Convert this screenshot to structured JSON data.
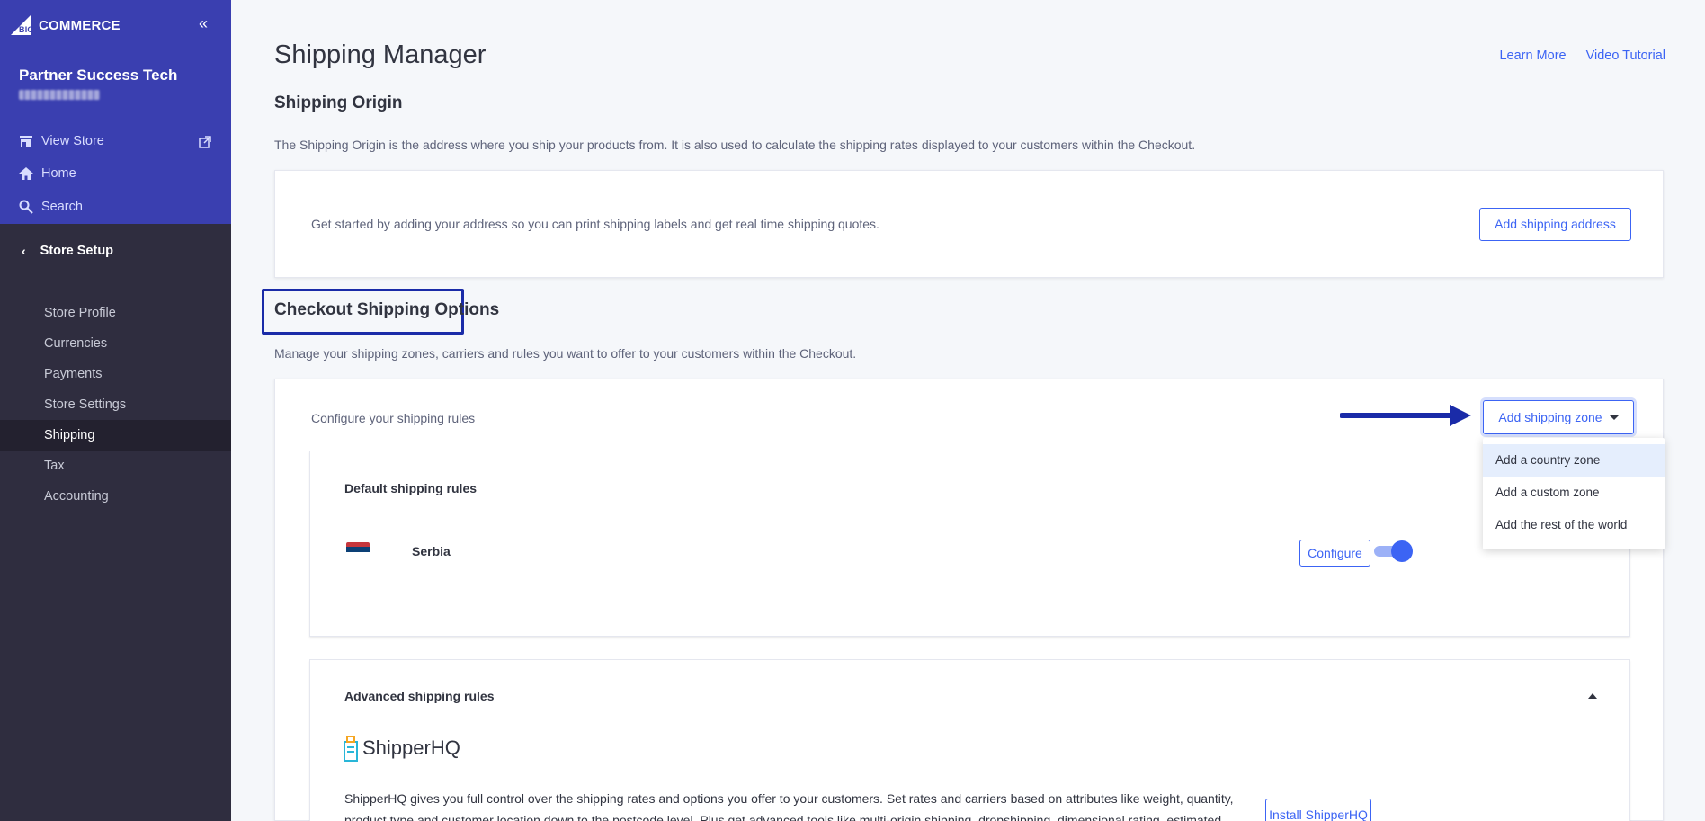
{
  "brand": {
    "logo_text": "COMMERCE",
    "logo_mark": "BIG"
  },
  "sidebar": {
    "store_name": "Partner Success Tech",
    "top_items": [
      {
        "label": "View Store"
      },
      {
        "label": "Home"
      },
      {
        "label": "Search"
      }
    ],
    "section": "Store Setup",
    "sub_items": [
      {
        "label": "Store Profile"
      },
      {
        "label": "Currencies"
      },
      {
        "label": "Payments"
      },
      {
        "label": "Store Settings"
      },
      {
        "label": "Shipping"
      },
      {
        "label": "Tax"
      },
      {
        "label": "Accounting"
      }
    ],
    "active": "Shipping"
  },
  "header": {
    "title": "Shipping Manager",
    "links": {
      "learn_more": "Learn More",
      "video_tutorial": "Video Tutorial"
    }
  },
  "origin": {
    "title": "Shipping Origin",
    "description": "The Shipping Origin is the address where you ship your products from. It is also used to calculate the shipping rates displayed to your customers within the Checkout.",
    "card_text": "Get started by adding your address so you can print shipping labels and get real time shipping quotes.",
    "button": "Add shipping address"
  },
  "checkout": {
    "title": "Checkout Shipping Options",
    "description": "Manage your shipping zones, carriers and rules you want to offer to your customers within the Checkout.",
    "configure_text": "Configure your shipping rules",
    "add_zone_button": "Add shipping zone",
    "dropdown": [
      {
        "label": "Add a country zone"
      },
      {
        "label": "Add a custom zone"
      },
      {
        "label": "Add the rest of the world"
      }
    ],
    "default_rules": {
      "title": "Default shipping rules",
      "country": "Serbia",
      "enabled": true,
      "configure_button": "Configure"
    },
    "advanced_rules": {
      "title": "Advanced shipping rules",
      "logo_text": "ShipperHQ",
      "description": "ShipperHQ gives you full control over the shipping rates and options you offer to your customers. Set rates and carriers based on attributes like weight, quantity, product type and customer location down to the postcode level. Plus get advanced tools like multi-origin shipping, dropshipping, dimensional rating, estimated",
      "install_button": "Install ShipperHQ"
    }
  },
  "colors": {
    "sidebar_top": "#3a3fb0",
    "sidebar_bottom": "#2f2d3f",
    "accent": "#3c64f4",
    "highlight": "#1a2ba8"
  },
  "icons": [
    "collapse-icon",
    "store-icon",
    "external-link-icon",
    "home-icon",
    "search-icon",
    "chevron-left-icon",
    "arrow-annotation-icon",
    "caret-down-icon",
    "serbia-flag-icon",
    "chevron-up-icon",
    "shipperhq-logo-icon"
  ]
}
